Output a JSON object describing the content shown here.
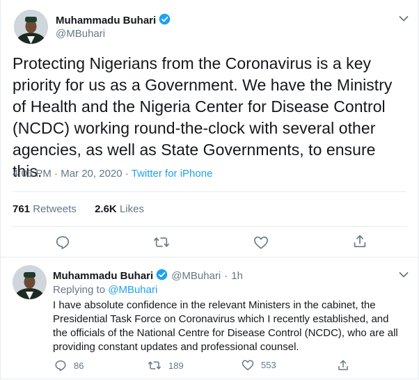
{
  "tweet": {
    "author_name": "Muhammadu Buhari",
    "author_handle": "@MBuhari",
    "text": "Protecting Nigerians from the Coronavirus is a key priority for us as a Government. We have the Ministry of Health and the Nigeria Center for Disease Control (NCDC) working round-the-clock with several other agencies, as well as State Governments, to ensure this.",
    "time": "4:03 PM",
    "date": "Mar 20, 2020",
    "separator": "·",
    "source": "Twitter for iPhone",
    "retweets_count": "761",
    "retweets_label": "Retweets",
    "likes_count": "2.6K",
    "likes_label": "Likes"
  },
  "reply": {
    "author_name": "Muhammadu Buhari",
    "author_handle": "@MBuhari",
    "separator": "·",
    "time_ago": "1h",
    "replying_prefix": "Replying to",
    "replying_to": "@MBuhari",
    "text": "I have absolute confidence in the relevant Ministers in the cabinet, the Presidential Task Force on Coronavirus which I recently established, and the officials of the National Centre for Disease Control (NCDC), who are all providing constant updates and professional counsel.",
    "replies_count": "86",
    "retweets_count": "189",
    "likes_count": "553"
  },
  "icons": {
    "verified": "verified-badge-icon",
    "menu": "chevron-down-icon",
    "reply": "comment-icon",
    "retweet": "retweet-icon",
    "like": "heart-icon",
    "share": "share-icon"
  },
  "colors": {
    "accent": "#1da1f2",
    "secondary_text": "#657786",
    "primary_text": "#14171a",
    "divider": "#e6ecf0"
  }
}
